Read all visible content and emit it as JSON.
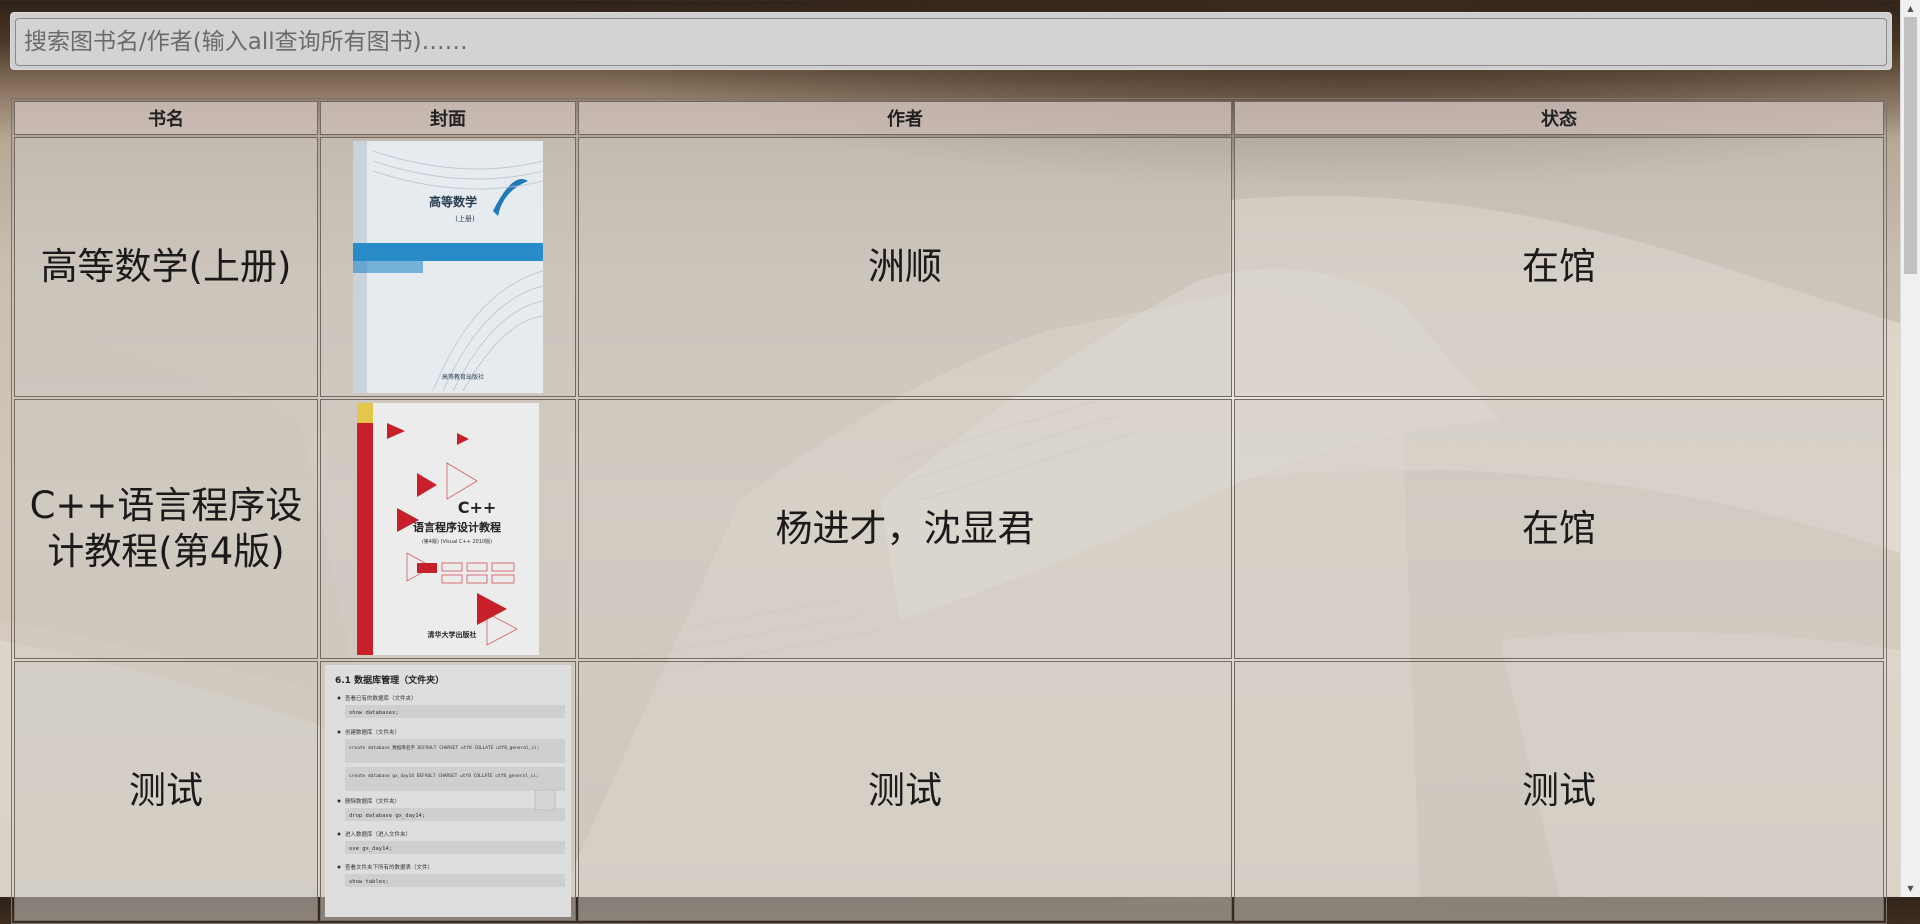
{
  "search": {
    "placeholder": "搜索图书名/作者(输入all查询所有图书)……"
  },
  "table": {
    "headers": [
      "书名",
      "封面",
      "作者",
      "状态"
    ],
    "rows": [
      {
        "title": "高等数学(上册)",
        "cover": {
          "title": "高等数学",
          "subtitle": "(上册)",
          "publisher": "高等教育出版社"
        },
        "author": "洲顺",
        "status": "在馆"
      },
      {
        "title": "C++语言程序设计教程(第4版)",
        "cover": {
          "title_en": "C++",
          "title": "语言程序设计教程",
          "subtitle": "(第4版) (Visual C++ 2010版)",
          "publisher": "清华大学出版社"
        },
        "author": "杨进才，沈显君",
        "status": "在馆"
      },
      {
        "title": "测试",
        "cover": {
          "heading": "6.1 数据库管理（文件夹）",
          "items": [
            "查看已有的数据库（文件夹）",
            "show databases;",
            "创建数据库（文件夹）",
            "create database 数据库名字 DEFAULT CHARSET utf8 COLLATE utf8_general_ci;",
            "create database gx_day14 DEFAULT CHARSET utf8 COLLATE utf8_general_ci;",
            "删除数据库（文件夹）",
            "drop database gx_day14;",
            "进入数据库（进入文件夹）",
            "use gx_day14;",
            "查看文件夹下所有的数据表（文件）",
            "show tables;"
          ]
        },
        "author": "测试",
        "status": "测试"
      }
    ]
  },
  "colors": {
    "header_bg": "#cdbeb8",
    "cell_bg": "#cdcac4",
    "border": "#6f6a66",
    "cpp_red": "#c8202a"
  }
}
